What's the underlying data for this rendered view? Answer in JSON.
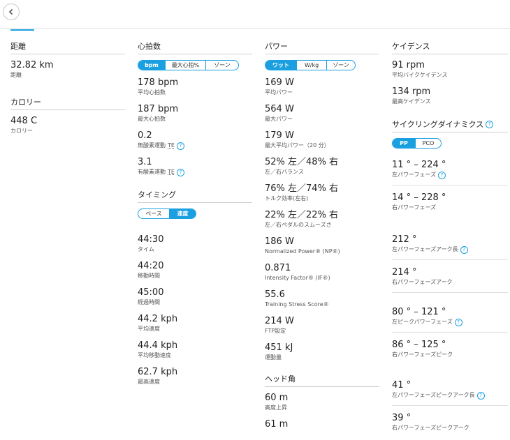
{
  "distance": {
    "title": "距離",
    "value": "32.82 km",
    "label": "距離"
  },
  "calories": {
    "title": "カロリー",
    "value": "448 C",
    "label": "カロリー"
  },
  "heart_rate": {
    "title": "心拍数",
    "seg": [
      "bpm",
      "最大心拍%",
      "ゾーン"
    ],
    "stats": [
      {
        "v": "178 bpm",
        "l": "平均心拍数"
      },
      {
        "v": "187 bpm",
        "l": "最大心拍数"
      },
      {
        "v": "0.2",
        "l": "無酸素運動",
        "te": "TE"
      },
      {
        "v": "3.1",
        "l": "有酸素運動",
        "te": "TE"
      }
    ]
  },
  "timing": {
    "title": "タイミング",
    "seg": [
      "ペース",
      "速度"
    ],
    "stats": [
      {
        "v": "44:30",
        "l": "タイム"
      },
      {
        "v": "44:20",
        "l": "移動時間"
      },
      {
        "v": "45:00",
        "l": "経過時間"
      },
      {
        "v": "44.2 kph",
        "l": "平均速度"
      },
      {
        "v": "44.4 kph",
        "l": "平均移動速度"
      },
      {
        "v": "62.7 kph",
        "l": "最高速度"
      }
    ]
  },
  "power": {
    "title": "パワー",
    "seg": [
      "ワット",
      "W/kg",
      "ゾーン"
    ],
    "stats": [
      {
        "v": "169 W",
        "l": "平均パワー"
      },
      {
        "v": "564 W",
        "l": "最大パワー"
      },
      {
        "v": "179 W",
        "l": "最大平均パワー（20 分）"
      },
      {
        "v": "52% 左／48% 右",
        "l": "左／右バランス"
      },
      {
        "v": "76% 左／74% 右",
        "l": "トルク効率(左右)"
      },
      {
        "v": "22% 左／22% 右",
        "l": "左／右ペダルのスムーズさ"
      },
      {
        "v": "186 W",
        "l": "Normalized Power® (NP®)"
      },
      {
        "v": "0.871",
        "l": "Intensity Factor® (IF®)"
      },
      {
        "v": "55.6",
        "l": "Training Stress Score®"
      },
      {
        "v": "214 W",
        "l": "FTP設定"
      },
      {
        "v": "451 kJ",
        "l": "運動量"
      }
    ]
  },
  "head_angle": {
    "title": "ヘッド角",
    "stats": [
      {
        "v": "60 m",
        "l": "高度上昇"
      },
      {
        "v": "61 m",
        "l": ""
      }
    ]
  },
  "cadence": {
    "title": "ケイデンス",
    "stats": [
      {
        "v": "91 rpm",
        "l": "平均バイクケイデンス"
      },
      {
        "v": "134 rpm",
        "l": "最高ケイデンス"
      }
    ]
  },
  "dynamics": {
    "title": "サイクリングダイナミクス",
    "seg": [
      "PP",
      "PCO"
    ],
    "stats": [
      {
        "v": "11 ° – 224 °",
        "l": "左パワーフェーズ"
      },
      {
        "v": "14 ° – 228 °",
        "l": "右パワーフェーズ"
      },
      {
        "v": "212 °",
        "l": "左パワーフェーズアーク長"
      },
      {
        "v": "214 °",
        "l": "右パワーフェーズアーク"
      },
      {
        "v": "80 ° – 121 °",
        "l": "左ピークパワーフェーズ"
      },
      {
        "v": "86 ° – 125 °",
        "l": "右パワーフェーズピーク"
      },
      {
        "v": "41 °",
        "l": "左パワーフェーズピークアーク長"
      },
      {
        "v": "39 °",
        "l": "右パワーフェーズピークアーク"
      }
    ]
  }
}
